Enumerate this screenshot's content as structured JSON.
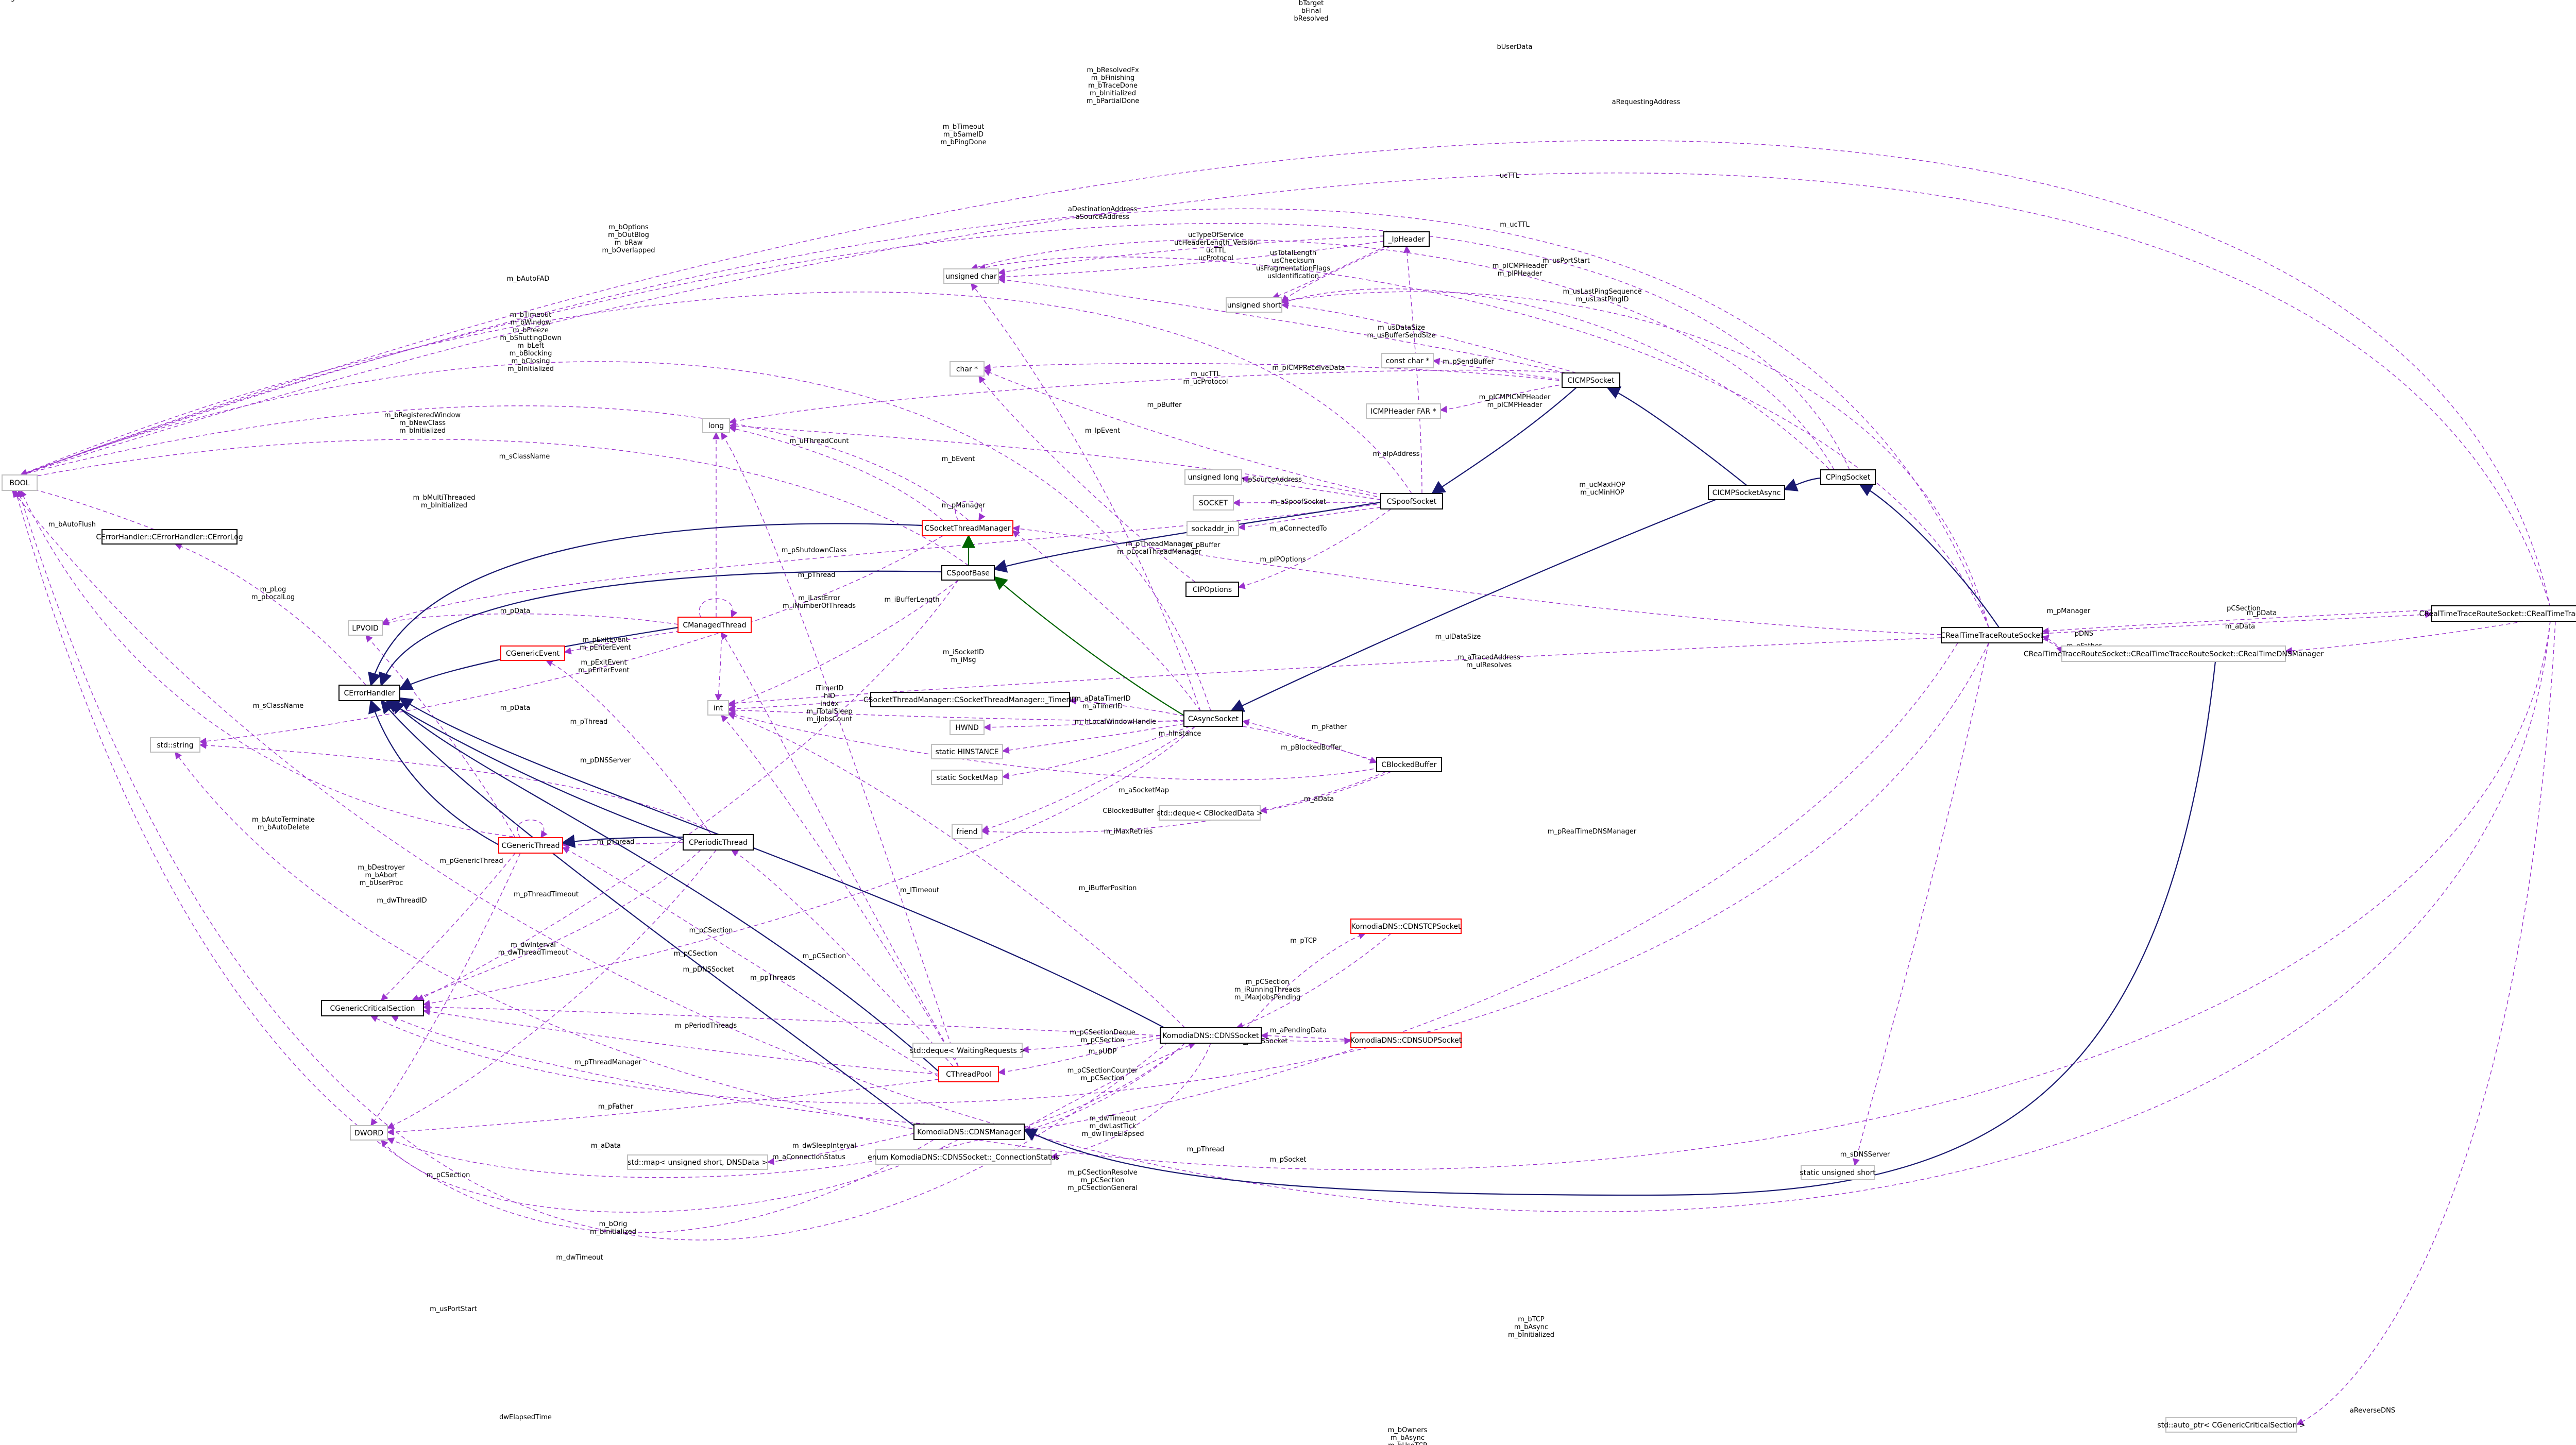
{
  "diagram": {
    "nodes": [
      {
        "id": "bool",
        "label": "BOOL",
        "style": "plain"
      },
      {
        "id": "errorlog",
        "label": "CErrorHandler::CErrorHandler::CErrorLog",
        "style": "black"
      },
      {
        "id": "lpvoid",
        "label": "LPVOID",
        "style": "plain"
      },
      {
        "id": "cerrorhandler",
        "label": "CErrorHandler",
        "style": "black"
      },
      {
        "id": "stdstring",
        "label": "std::string",
        "style": "plain"
      },
      {
        "id": "cgenericevent",
        "label": "CGenericEvent",
        "style": "red"
      },
      {
        "id": "cmanagedthread",
        "label": "CManagedThread",
        "style": "red"
      },
      {
        "id": "cgenericthread",
        "label": "CGenericThread",
        "style": "red"
      },
      {
        "id": "cperiodicthread",
        "label": "CPeriodicThread",
        "style": "black"
      },
      {
        "id": "ccritsec",
        "label": "CGenericCriticalSection",
        "style": "black"
      },
      {
        "id": "dword",
        "label": "DWORD",
        "style": "plain"
      },
      {
        "id": "long",
        "label": "long",
        "style": "plain"
      },
      {
        "id": "int",
        "label": "int",
        "style": "plain"
      },
      {
        "id": "ucharp",
        "label": "unsigned char",
        "style": "plain"
      },
      {
        "id": "ushort",
        "label": "unsigned short",
        "style": "plain"
      },
      {
        "id": "charp",
        "label": "char *",
        "style": "plain"
      },
      {
        "id": "constcharp",
        "label": "const char *",
        "style": "plain"
      },
      {
        "id": "icmpfar",
        "label": "ICMPHeader FAR *",
        "style": "plain"
      },
      {
        "id": "ulong",
        "label": "unsigned long",
        "style": "plain"
      },
      {
        "id": "socket",
        "label": "SOCKET",
        "style": "plain"
      },
      {
        "id": "sockaddr",
        "label": "sockaddr_in",
        "style": "plain"
      },
      {
        "id": "ipheader",
        "label": "_IpHeader",
        "style": "black"
      },
      {
        "id": "cicmpsocket",
        "label": "CICMPSocket",
        "style": "black"
      },
      {
        "id": "cspoofsocket",
        "label": "CSpoofSocket",
        "style": "black"
      },
      {
        "id": "cicmpasync",
        "label": "CICMPSocketAsync",
        "style": "black"
      },
      {
        "id": "cpingsocket",
        "label": "CPingSocket",
        "style": "black"
      },
      {
        "id": "cipoptions",
        "label": "CIPOptions",
        "style": "black"
      },
      {
        "id": "csocketthreadmgr",
        "label": "CSocketThreadManager",
        "style": "red"
      },
      {
        "id": "cspoofbase",
        "label": "CSpoofBase",
        "style": "black"
      },
      {
        "id": "ctimerid",
        "label": "CSocketThreadManager::CSocketThreadManager::_TimerID",
        "style": "black"
      },
      {
        "id": "hwnd",
        "label": "HWND",
        "style": "plain"
      },
      {
        "id": "hinstance",
        "label": "static HINSTANCE",
        "style": "plain"
      },
      {
        "id": "socketmap",
        "label": "static SocketMap",
        "style": "plain"
      },
      {
        "id": "casyncsocket",
        "label": "CAsyncSocket",
        "style": "black"
      },
      {
        "id": "cblockedbuffer",
        "label": "CBlockedBuffer",
        "style": "black"
      },
      {
        "id": "dequeblocked",
        "label": "std::deque< CBlockedData >",
        "style": "plain"
      },
      {
        "id": "friend",
        "label": "friend",
        "style": "plain"
      },
      {
        "id": "dnstcp",
        "label": "KomodiaDNS::CDNSTCPSocket",
        "style": "red"
      },
      {
        "id": "dnsudp",
        "label": "KomodiaDNS::CDNSUDPSocket",
        "style": "red"
      },
      {
        "id": "cdnssocket",
        "label": "KomodiaDNS::CDNSSocket",
        "style": "black"
      },
      {
        "id": "dequewaiting",
        "label": "std::deque< WaitingRequests >",
        "style": "plain"
      },
      {
        "id": "cthreadpool",
        "label": "CThreadPool",
        "style": "red"
      },
      {
        "id": "cdnsmanager",
        "label": "KomodiaDNS::CDNSManager",
        "style": "black"
      },
      {
        "id": "enumconn",
        "label": "enum KomodiaDNS::CDNSSocket::_ConnectionStatus",
        "style": "plain"
      },
      {
        "id": "mapdns",
        "label": "std::map< unsigned short, DNSData >",
        "style": "plain"
      },
      {
        "id": "staticushort",
        "label": "static unsigned short",
        "style": "plain"
      },
      {
        "id": "autoptr",
        "label": "std::auto_ptr< CGenericCriticalSection >",
        "style": "plain"
      },
      {
        "id": "crttrs",
        "label": "CRealTimeTraceRouteSocket",
        "style": "focus"
      },
      {
        "id": "tracedata",
        "label": "CRealTimeTraceRouteSocket::CRealTimeTraceRouteSocket::_TraceRouteData",
        "style": "black"
      },
      {
        "id": "dnsmgr2",
        "label": "CRealTimeTraceRouteSocket::CRealTimeTraceRouteSocket::CRealTimeDNSManager",
        "style": "plain"
      }
    ],
    "edge_labels": [
      "bTarget\nbFinal\nbResolved",
      "bUserData",
      "m_bResolvedFx\nm_bFinishing\nm_bTraceDone\nm_bInitialized\nm_bPartialDone",
      "m_bTimeout\nm_bSameID\nm_bPingDone",
      "m_bOptions\nm_bOutBlog\nm_bRaw\nm_bOverlapped",
      "m_bAutoFAD",
      "m_bTimeout\nm_bWindow\nm_bFreeze\nm_bShuttingDown\nm_bLeft\nm_bBlocking\nm_bClosing\nm_bInitialized",
      "m_bRegisteredWindow\nm_bNewClass\nm_bInitialized",
      "m_sClassName",
      "m_bMultiThreaded\nm_bInitialized",
      "m_bAutoFlush",
      "m_pLog\nm_pLocalLog",
      "m_sClassName",
      "aRequestingAddress",
      "ucTTL",
      "aDestinationAddress\naSourceAddress",
      "ucTypeOfService\nucHeaderLength_Version\nucTTL\nucProtocol",
      "usTotalLength\nusChecksum\nusFragmentationFlags\nusIdentification",
      "m_ucTTL",
      "m_pICMPHeader\nm_pIPHeader",
      "m_usPortStart",
      "m_usLastPingSequence\nm_usLastPingID",
      "m_usDataSize\nm_usBufferSendSize",
      "m_pSendBuffer",
      "m_pICMPReceiveData",
      "m_pICMPICMPHeader\nm_pICMPHeader",
      "m_ucTTL\nm_ucProtocol",
      "m_pBuffer",
      "m_bEvent",
      "m_ulThreadCount",
      "m_lpEvent",
      "m_aIpAddress",
      "m_ucMaxHOP\nm_ucMinHOP",
      "m_pSourceAddress",
      "m_aSpoofSocket",
      "m_aConnectedTo",
      "m_pIPOptions",
      "m_pBuffer",
      "m_pManager",
      "m_pThreadManager\nm_pLocalThreadManager",
      "m_pShutdownClass",
      "m_pThread",
      "m_iBufferLength",
      "m_iLastError\nm_iNumberOfThreads",
      "m_iSocketID\nm_iMsg",
      "m_ulDataSize",
      "m_aTracedAddress\nm_ulResolves",
      "m_pData",
      "m_pManager",
      "m_pData",
      "m_pExitEvent\nm_pEnterEvent",
      "m_pData",
      "m_pThread",
      "m_pExitEvent\nm_pEnterEvent",
      "iTimerID\nhID\nindex\nm_iTotalSleep\nm_iJobsCount",
      "m_aDataTimerID\nm_aTimerID",
      "m_hLocalWindowHandle",
      "m_hInstance",
      "m_aSocketMap",
      "m_pFather",
      "m_pBlockedBuffer",
      "CBlockedBuffer",
      "m_aData",
      "m_iMaxRetries",
      "m_iBufferPosition",
      "m_pRealTimeDNSManager",
      "m_pDNSServer",
      "m_bAutoTerminate\nm_bAutoDelete",
      "m_pGenericThread",
      "m_bDestroyer\nm_bAbort\nm_bUserProc",
      "m_dwThreadID",
      "m_pThreadTimeout",
      "m_dwInterval\nm_dwThreadTimeout",
      "m_pThread",
      "m_pCSection",
      "m_pCSection",
      "m_lTimeout",
      "m_pTCP",
      "m_pCSection",
      "m_pCSection\nm_iRunningThreads\nm_iMaxJobsPending",
      "m_pDNSSocket",
      "m_ppThreads",
      "m_pPeriodThreads",
      "m_pCSectionDeque\nm_pCSection",
      "m_aPendingData",
      "m_pDNSSocket",
      "m_pUDP",
      "m_pThreadManager",
      "m_pCSectionCounter\nm_pCSection",
      "m_pFather",
      "m_dwSleepInterval",
      "m_pThread",
      "m_dwTimeout\nm_dwLastTick\nm_dwTimeElapsed",
      "m_pSocket",
      "m_pCSectionResolve\nm_pCSection\nm_pCSectionGeneral",
      "m_aConnectionStatus",
      "m_aData",
      "m_pCSection",
      "m_bOrig\nm_bInitialized",
      "m_dwTimeout",
      "m_sDNSServer",
      "m_usPortStart",
      "m_bTCP\nm_bAsync\nm_bInitialized",
      "dwElapsedTime",
      "m_bOwners\nm_bAsync\nm_bUseTCP\nm_bAsyncConnect",
      "aReverseDNS",
      "pCSection",
      "m_aData",
      "pDNS",
      "m_pFather",
      "m_pManager"
    ]
  }
}
